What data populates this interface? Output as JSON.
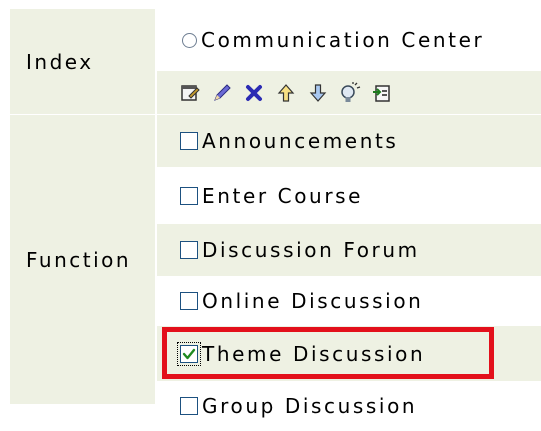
{
  "index": {
    "label": "Index",
    "radio_label": "Communication Center",
    "toolbar_icons": [
      "edit-page-icon",
      "pencil-icon",
      "delete-x-icon",
      "move-up-arrow-icon",
      "move-down-arrow-icon",
      "bulb-idea-icon",
      "export-icon"
    ]
  },
  "function": {
    "label": "Function",
    "items": [
      {
        "label": "Announcements",
        "checked": false
      },
      {
        "label": "Enter Course",
        "checked": false
      },
      {
        "label": "Discussion Forum",
        "checked": false
      },
      {
        "label": "Online Discussion",
        "checked": false
      },
      {
        "label": "Theme Discussion",
        "checked": true
      },
      {
        "label": "Group Discussion",
        "checked": false
      }
    ]
  },
  "colors": {
    "row_alt": "#eef1e3",
    "highlight": "#e3101b",
    "checkbox_border": "#1d5180",
    "checkmark": "#1f8a1f"
  }
}
